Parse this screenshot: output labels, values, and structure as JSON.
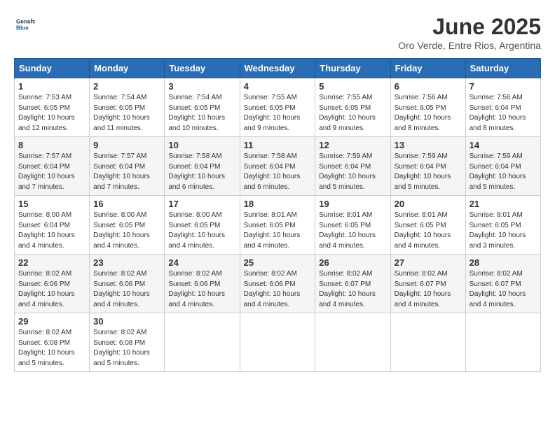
{
  "logo": {
    "general": "General",
    "blue": "Blue"
  },
  "title": "June 2025",
  "subtitle": "Oro Verde, Entre Rios, Argentina",
  "days_of_week": [
    "Sunday",
    "Monday",
    "Tuesday",
    "Wednesday",
    "Thursday",
    "Friday",
    "Saturday"
  ],
  "weeks": [
    [
      {
        "day": "1",
        "sunrise": "7:53 AM",
        "sunset": "6:05 PM",
        "daylight": "10 hours and 12 minutes."
      },
      {
        "day": "2",
        "sunrise": "7:54 AM",
        "sunset": "6:05 PM",
        "daylight": "10 hours and 11 minutes."
      },
      {
        "day": "3",
        "sunrise": "7:54 AM",
        "sunset": "6:05 PM",
        "daylight": "10 hours and 10 minutes."
      },
      {
        "day": "4",
        "sunrise": "7:55 AM",
        "sunset": "6:05 PM",
        "daylight": "10 hours and 9 minutes."
      },
      {
        "day": "5",
        "sunrise": "7:55 AM",
        "sunset": "6:05 PM",
        "daylight": "10 hours and 9 minutes."
      },
      {
        "day": "6",
        "sunrise": "7:56 AM",
        "sunset": "6:05 PM",
        "daylight": "10 hours and 8 minutes."
      },
      {
        "day": "7",
        "sunrise": "7:56 AM",
        "sunset": "6:04 PM",
        "daylight": "10 hours and 8 minutes."
      }
    ],
    [
      {
        "day": "8",
        "sunrise": "7:57 AM",
        "sunset": "6:04 PM",
        "daylight": "10 hours and 7 minutes."
      },
      {
        "day": "9",
        "sunrise": "7:57 AM",
        "sunset": "6:04 PM",
        "daylight": "10 hours and 7 minutes."
      },
      {
        "day": "10",
        "sunrise": "7:58 AM",
        "sunset": "6:04 PM",
        "daylight": "10 hours and 6 minutes."
      },
      {
        "day": "11",
        "sunrise": "7:58 AM",
        "sunset": "6:04 PM",
        "daylight": "10 hours and 6 minutes."
      },
      {
        "day": "12",
        "sunrise": "7:59 AM",
        "sunset": "6:04 PM",
        "daylight": "10 hours and 5 minutes."
      },
      {
        "day": "13",
        "sunrise": "7:59 AM",
        "sunset": "6:04 PM",
        "daylight": "10 hours and 5 minutes."
      },
      {
        "day": "14",
        "sunrise": "7:59 AM",
        "sunset": "6:04 PM",
        "daylight": "10 hours and 5 minutes."
      }
    ],
    [
      {
        "day": "15",
        "sunrise": "8:00 AM",
        "sunset": "6:04 PM",
        "daylight": "10 hours and 4 minutes."
      },
      {
        "day": "16",
        "sunrise": "8:00 AM",
        "sunset": "6:05 PM",
        "daylight": "10 hours and 4 minutes."
      },
      {
        "day": "17",
        "sunrise": "8:00 AM",
        "sunset": "6:05 PM",
        "daylight": "10 hours and 4 minutes."
      },
      {
        "day": "18",
        "sunrise": "8:01 AM",
        "sunset": "6:05 PM",
        "daylight": "10 hours and 4 minutes."
      },
      {
        "day": "19",
        "sunrise": "8:01 AM",
        "sunset": "6:05 PM",
        "daylight": "10 hours and 4 minutes."
      },
      {
        "day": "20",
        "sunrise": "8:01 AM",
        "sunset": "6:05 PM",
        "daylight": "10 hours and 4 minutes."
      },
      {
        "day": "21",
        "sunrise": "8:01 AM",
        "sunset": "6:05 PM",
        "daylight": "10 hours and 3 minutes."
      }
    ],
    [
      {
        "day": "22",
        "sunrise": "8:02 AM",
        "sunset": "6:06 PM",
        "daylight": "10 hours and 4 minutes."
      },
      {
        "day": "23",
        "sunrise": "8:02 AM",
        "sunset": "6:06 PM",
        "daylight": "10 hours and 4 minutes."
      },
      {
        "day": "24",
        "sunrise": "8:02 AM",
        "sunset": "6:06 PM",
        "daylight": "10 hours and 4 minutes."
      },
      {
        "day": "25",
        "sunrise": "8:02 AM",
        "sunset": "6:06 PM",
        "daylight": "10 hours and 4 minutes."
      },
      {
        "day": "26",
        "sunrise": "8:02 AM",
        "sunset": "6:07 PM",
        "daylight": "10 hours and 4 minutes."
      },
      {
        "day": "27",
        "sunrise": "8:02 AM",
        "sunset": "6:07 PM",
        "daylight": "10 hours and 4 minutes."
      },
      {
        "day": "28",
        "sunrise": "8:02 AM",
        "sunset": "6:07 PM",
        "daylight": "10 hours and 4 minutes."
      }
    ],
    [
      {
        "day": "29",
        "sunrise": "8:02 AM",
        "sunset": "6:08 PM",
        "daylight": "10 hours and 5 minutes."
      },
      {
        "day": "30",
        "sunrise": "8:02 AM",
        "sunset": "6:08 PM",
        "daylight": "10 hours and 5 minutes."
      },
      null,
      null,
      null,
      null,
      null
    ]
  ]
}
